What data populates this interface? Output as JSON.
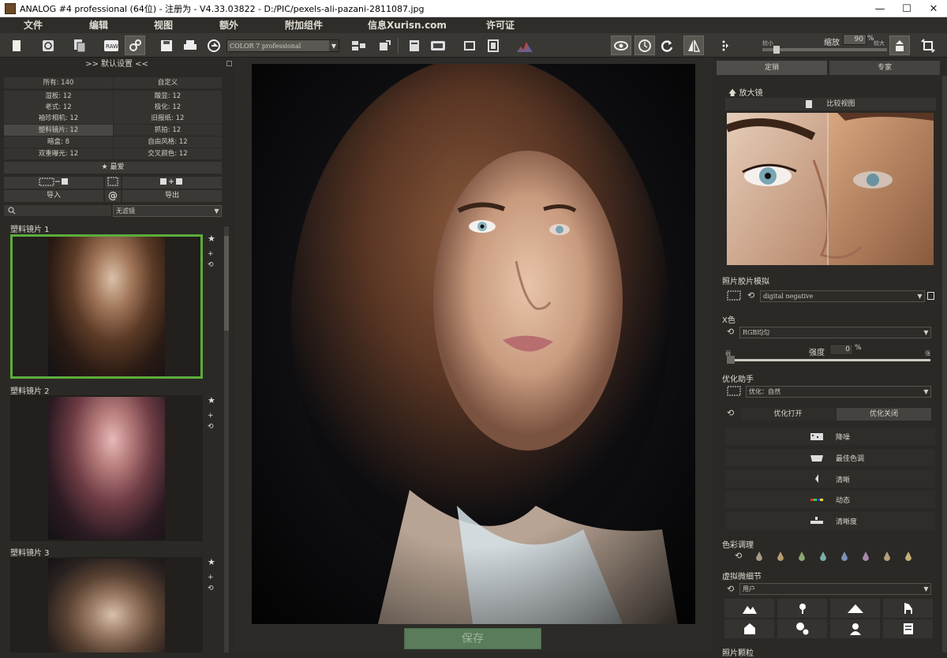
{
  "window": {
    "title": "ANALOG #4 professional (64位) - 注册为 - V4.33.03822 - D:/PIC/pexels-ali-pazani-2811087.jpg",
    "min": "—",
    "max": "☐",
    "close": "✕"
  },
  "menu": [
    "文件",
    "编辑",
    "视图",
    "额外",
    "附加组件",
    "信息Xurisn.com",
    "许可证"
  ],
  "toolbar": {
    "preset_combo": "COLOR 7 professional",
    "zoom_small_label": "较小",
    "zoom_label": "缩放",
    "zoom_value": "90",
    "zoom_pct": "%",
    "zoom_large_label": "较大"
  },
  "left": {
    "header": ">> 默认设置 <<",
    "categories": [
      [
        "所有: 140",
        "自定义"
      ],
      [
        "湿板: 12",
        "酸显: 12"
      ],
      [
        "老式: 12",
        "极化: 12"
      ],
      [
        "袖珍相机: 12",
        "旧报纸: 12"
      ],
      [
        "塑料镜片: 12",
        "抓拍: 12"
      ],
      [
        "暗盒: 8",
        "自由风格: 12"
      ],
      [
        "双重曝光: 12",
        "交叉颜色: 12"
      ]
    ],
    "favorites": "★ 最爱",
    "import": "导入",
    "at": "@",
    "export": "导出",
    "filter_combo": "无滤镜",
    "thumbs": [
      "塑料镜片 1",
      "塑料镜片 2",
      "塑料镜片 3"
    ]
  },
  "center": {
    "save": "保存"
  },
  "right": {
    "tabs": [
      "定销",
      "专家"
    ],
    "magnifier": "放大镜",
    "compare_view": "比较视图",
    "film_sim": "照片胶片模拟",
    "film_combo": "digital negative",
    "x_color": "X色",
    "rgb_combo": "RGB均匀",
    "strength_label": "强度",
    "strength_value": "0",
    "strength_pct": "%",
    "strength_min": "弱",
    "strength_max": "强",
    "optimize": "优化助手",
    "optimize_combo": "优化：自然",
    "opt_on": "优化打开",
    "opt_off": "优化关闭",
    "opt_items": [
      "降噪",
      "最佳色调",
      "清晰",
      "动态",
      "清晰度"
    ],
    "color_tone": "色彩调理",
    "micro_detail": "虚拟微细节",
    "user_combo": "用户",
    "next_section": "照片颗粒"
  },
  "colors": {
    "accent_green": "#5cad3c",
    "save_green": "#5a7c5a"
  }
}
